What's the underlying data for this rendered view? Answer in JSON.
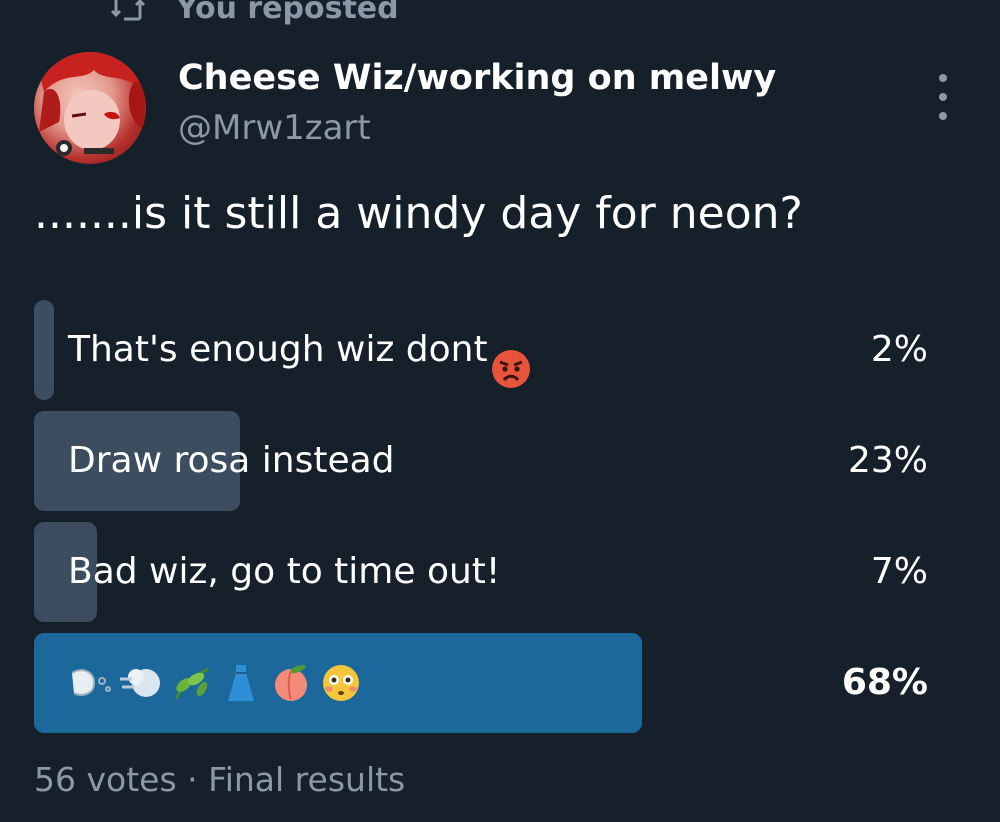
{
  "repost": {
    "label": "You reposted",
    "icon": "repost-icon"
  },
  "author": {
    "name": "Cheese Wiz/working on melwy",
    "handle": "@Mrw1zart",
    "avatar_icon": "avatar-red-hair"
  },
  "tweet": {
    "text": ".......is it still a windy day for neon?"
  },
  "poll": {
    "options": [
      {
        "label": "That's enough wiz dont",
        "emoji": "angry-face-icon",
        "percent_label": "2%",
        "percent": 2
      },
      {
        "label": "Draw rosa instead",
        "emoji": "",
        "percent_label": "23%",
        "percent": 23
      },
      {
        "label": "Bad wiz, go to time out!",
        "emoji": "",
        "percent_label": "7%",
        "percent": 7
      },
      {
        "label": "",
        "emoji_sequence": [
          "dashing-away-icon",
          "wind-face-icon",
          "herb-icon",
          "dress-icon",
          "peach-icon",
          "flushed-face-icon"
        ],
        "percent_label": "68%",
        "percent": 68,
        "winner": true
      }
    ],
    "footer": {
      "votes": "56 votes",
      "separator": "·",
      "status": "Final results"
    }
  },
  "colors": {
    "background": "#15202b",
    "bar": "#3b4d5e",
    "winner_bar": "#1d689b",
    "muted_text": "#8b98a5"
  }
}
